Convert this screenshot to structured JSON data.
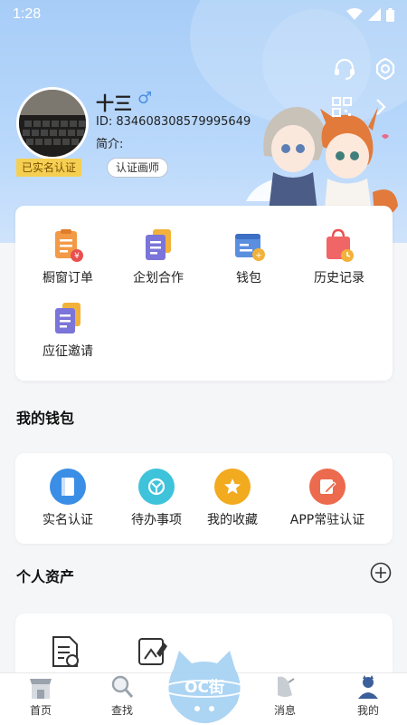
{
  "status_bar": {
    "time": "1:28"
  },
  "profile": {
    "name": "十三",
    "gender_symbol": "♂",
    "id_text": "ID: 834608308579995649",
    "intro_label": "简介:",
    "badge_verified": "已实名认证",
    "badge_artist": "认证画师"
  },
  "menu": {
    "items": [
      {
        "label": "橱窗订单",
        "icon": "order-icon"
      },
      {
        "label": "企划合作",
        "icon": "cooperation-icon"
      },
      {
        "label": "钱包",
        "icon": "wallet-icon"
      },
      {
        "label": "历史记录",
        "icon": "history-icon"
      },
      {
        "label": "应征邀请",
        "icon": "invitation-icon"
      }
    ]
  },
  "wallet": {
    "title": "我的钱包",
    "items": [
      {
        "label": "实名认证",
        "icon": "id-card-icon",
        "color": "#3b8ee6"
      },
      {
        "label": "待办事项",
        "icon": "todo-icon",
        "color": "#3ec3db"
      },
      {
        "label": "我的收藏",
        "icon": "star-icon",
        "color": "#f2aa1e"
      },
      {
        "label": "APP常驻认证",
        "icon": "edit-icon",
        "color": "#ec6a4d"
      }
    ]
  },
  "assets": {
    "title": "个人资产"
  },
  "tabbar": {
    "items": [
      {
        "label": "首页",
        "icon": "shop-icon"
      },
      {
        "label": "查找",
        "icon": "search-icon"
      },
      {
        "label": "",
        "icon": "oc-logo-icon"
      },
      {
        "label": "消息",
        "icon": "message-icon"
      },
      {
        "label": "我的",
        "icon": "profile-icon"
      }
    ],
    "center_logo_text": "OC街"
  },
  "colors": {
    "header": "#a7cdf7",
    "accent": "#4a90e2",
    "badge": "#f5cf52"
  }
}
